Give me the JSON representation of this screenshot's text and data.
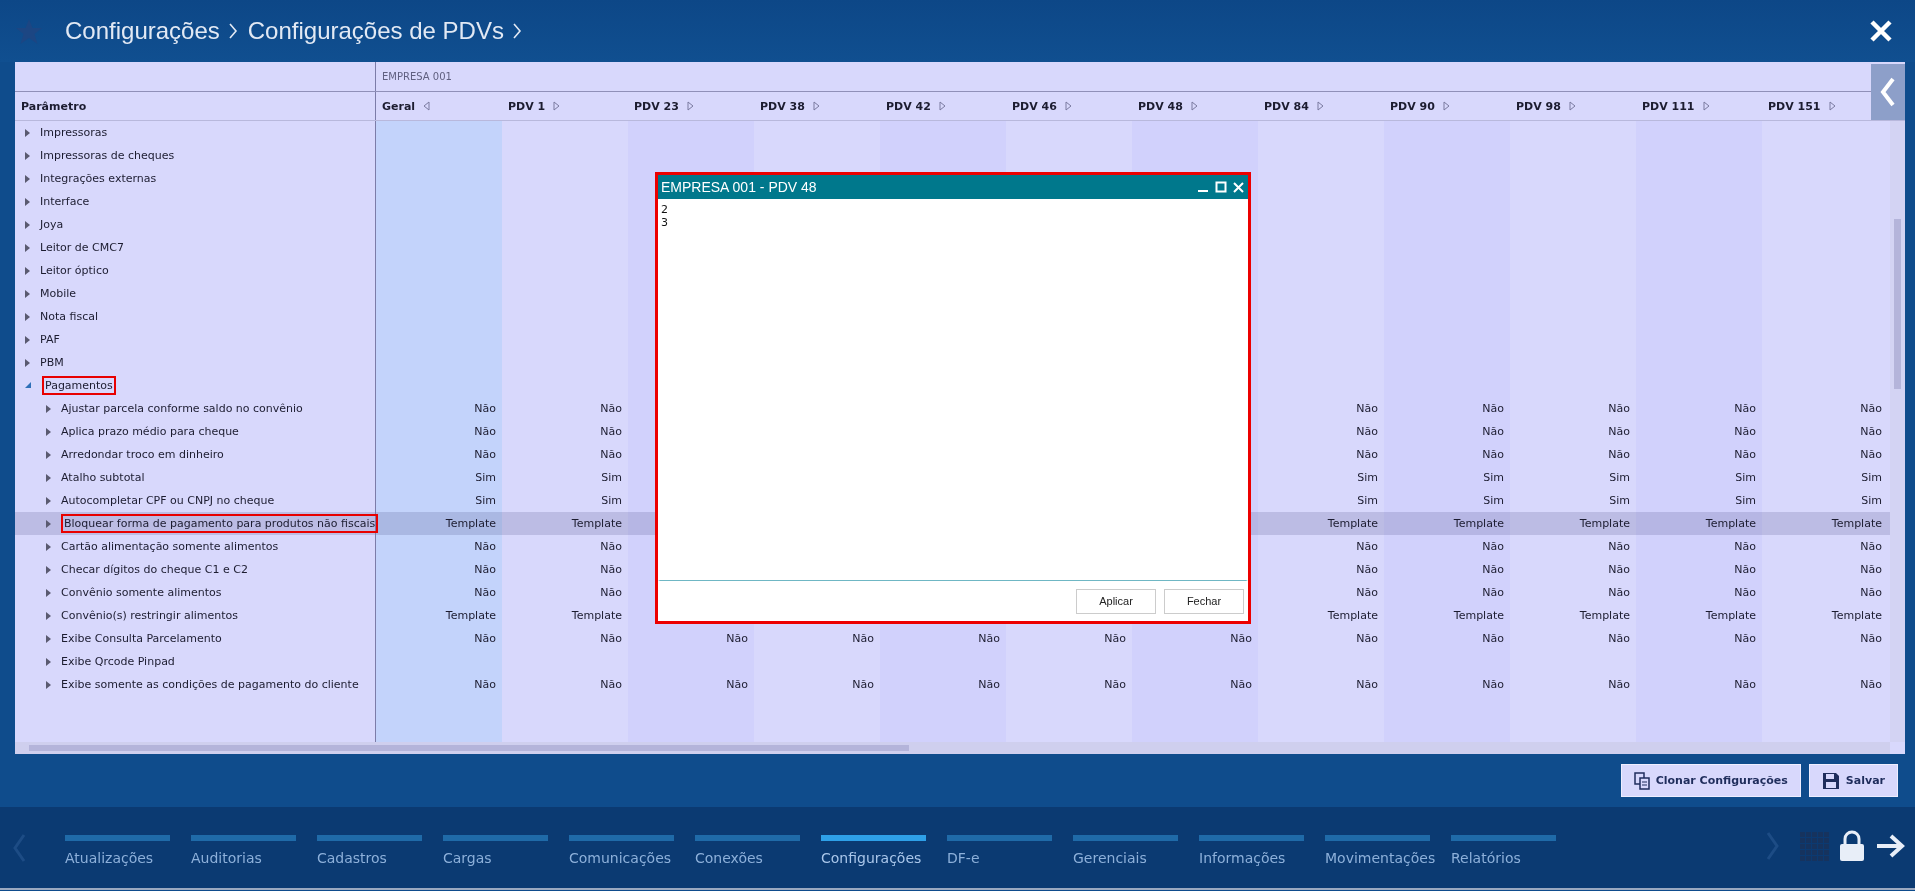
{
  "header": {
    "breadcrumbs": [
      "Configurações",
      "Configurações de PDVs"
    ]
  },
  "table": {
    "group": "EMPRESA 001",
    "first_column": "Parâmetro",
    "columns": [
      {
        "label": "Geral",
        "arrow_left": true
      },
      {
        "label": "PDV 1",
        "arrow_left": false
      },
      {
        "label": "PDV 23",
        "arrow_left": false
      },
      {
        "label": "PDV 38",
        "arrow_left": false
      },
      {
        "label": "PDV 42",
        "arrow_left": false
      },
      {
        "label": "PDV 46",
        "arrow_left": false
      },
      {
        "label": "PDV 48",
        "arrow_left": false
      },
      {
        "label": "PDV 84",
        "arrow_left": false
      },
      {
        "label": "PDV 90",
        "arrow_left": false
      },
      {
        "label": "PDV 98",
        "arrow_left": false
      },
      {
        "label": "PDV 111",
        "arrow_left": false
      },
      {
        "label": "PDV 151",
        "arrow_left": false
      }
    ],
    "rows": [
      {
        "label": "Impressoras",
        "expanded": false,
        "selected": false,
        "annotated": false
      },
      {
        "label": "Impressoras de cheques",
        "expanded": false,
        "selected": false,
        "annotated": false
      },
      {
        "label": "Integrações externas",
        "expanded": false,
        "selected": false,
        "annotated": false
      },
      {
        "label": "Interface",
        "expanded": false,
        "selected": false,
        "annotated": false
      },
      {
        "label": "Joya",
        "expanded": false,
        "selected": false,
        "annotated": false
      },
      {
        "label": "Leitor de CMC7",
        "expanded": false,
        "selected": false,
        "annotated": false
      },
      {
        "label": "Leitor óptico",
        "expanded": false,
        "selected": false,
        "annotated": false
      },
      {
        "label": "Mobile",
        "expanded": false,
        "selected": false,
        "annotated": false
      },
      {
        "label": "Nota fiscal",
        "expanded": false,
        "selected": false,
        "annotated": false
      },
      {
        "label": "PAF",
        "expanded": false,
        "selected": false,
        "annotated": false
      },
      {
        "label": "PBM",
        "expanded": false,
        "selected": false,
        "annotated": false
      },
      {
        "label": "Pagamentos",
        "expanded": true,
        "selected": false,
        "annotated": true,
        "children": [
          {
            "label": "Ajustar parcela conforme saldo no convênio",
            "expanded": false,
            "selected": false,
            "annotated": false,
            "values": [
              "Não",
              "Não"
            ],
            "trailing_values": [
              "Não",
              "Não",
              "Não",
              "Não",
              "Não"
            ]
          },
          {
            "label": "Aplica prazo médio para cheque",
            "expanded": false,
            "selected": false,
            "annotated": false,
            "values": [
              "Não",
              "Não"
            ],
            "trailing_values": [
              "Não",
              "Não",
              "Não",
              "Não",
              "Não"
            ]
          },
          {
            "label": "Arredondar troco em dinheiro",
            "expanded": false,
            "selected": false,
            "annotated": false,
            "values": [
              "Não",
              "Não"
            ],
            "trailing_values": [
              "Não",
              "Não",
              "Não",
              "Não",
              "Não"
            ]
          },
          {
            "label": "Atalho subtotal",
            "expanded": false,
            "selected": false,
            "annotated": false,
            "values": [
              "Sim",
              "Sim"
            ],
            "trailing_values": [
              "Sim",
              "Sim",
              "Sim",
              "Sim",
              "Sim"
            ]
          },
          {
            "label": "Autocompletar CPF ou CNPJ no cheque",
            "expanded": false,
            "selected": false,
            "annotated": false,
            "values": [
              "Sim",
              "Sim"
            ],
            "trailing_values": [
              "Sim",
              "Sim",
              "Sim",
              "Sim",
              "Sim"
            ]
          },
          {
            "label": "Bloquear forma de pagamento para produtos não fiscais",
            "expanded": false,
            "selected": true,
            "annotated": true,
            "values": [
              "Template",
              "Template"
            ],
            "trailing_values": [
              "Template",
              "Template",
              "Template",
              "Template",
              "Template"
            ]
          },
          {
            "label": "Cartão alimentação somente alimentos",
            "expanded": false,
            "selected": false,
            "annotated": false,
            "values": [
              "Não",
              "Não"
            ],
            "trailing_values": [
              "Não",
              "Não",
              "Não",
              "Não",
              "Não"
            ]
          },
          {
            "label": "Checar dígitos do cheque C1 e C2",
            "expanded": false,
            "selected": false,
            "annotated": false,
            "values": [
              "Não",
              "Não"
            ],
            "trailing_values": [
              "Não",
              "Não",
              "Não",
              "Não",
              "Não"
            ]
          },
          {
            "label": "Convênio somente alimentos",
            "expanded": false,
            "selected": false,
            "annotated": false,
            "values": [
              "Não",
              "Não"
            ],
            "trailing_values": [
              "Não",
              "Não",
              "Não",
              "Não",
              "Não"
            ]
          },
          {
            "label": "Convênio(s) restringir alimentos",
            "expanded": false,
            "selected": false,
            "annotated": false,
            "values": [
              "Template",
              "Template"
            ],
            "trailing_values": [
              "Template",
              "Template",
              "Template",
              "Template",
              "Template"
            ]
          },
          {
            "label": "Exibe Consulta Parcelamento",
            "expanded": false,
            "selected": false,
            "annotated": false,
            "values": [
              "Não",
              "Não",
              "Não",
              "Não",
              "Não",
              "Não",
              "Não",
              "Não",
              "Não",
              "Não",
              "Não",
              "Não"
            ]
          },
          {
            "label": "Exibe Qrcode Pinpad",
            "expanded": false,
            "selected": false,
            "annotated": false
          },
          {
            "label": "Exibe somente as condições de pagamento do cliente",
            "expanded": false,
            "selected": false,
            "annotated": false,
            "values": [
              "Não",
              "Não",
              "Não",
              "Não",
              "Não",
              "Não",
              "Não",
              "Não",
              "Não",
              "Não",
              "Não",
              "Não"
            ]
          }
        ]
      }
    ]
  },
  "dialog": {
    "title": "EMPRESA 001 - PDV 48",
    "text": "2\n3",
    "buttons": [
      "Aplicar",
      "Fechar"
    ],
    "annotated": true
  },
  "actions": [
    {
      "label": "Clonar Configurações",
      "kind": "copy"
    },
    {
      "label": "Salvar",
      "kind": "save"
    }
  ],
  "nav": {
    "items": [
      {
        "label": "Atualizações",
        "selected": false
      },
      {
        "label": "Auditorias",
        "selected": false
      },
      {
        "label": "Cadastros",
        "selected": false
      },
      {
        "label": "Cargas",
        "selected": false
      },
      {
        "label": "Comunicações",
        "selected": false
      },
      {
        "label": "Conexões",
        "selected": false
      },
      {
        "label": "Configurações",
        "selected": true
      },
      {
        "label": "DF-e",
        "selected": false
      },
      {
        "label": "Gerenciais",
        "selected": false
      },
      {
        "label": "Informações",
        "selected": false
      },
      {
        "label": "Movimentações",
        "selected": false
      },
      {
        "label": "Relatórios",
        "selected": false
      }
    ]
  }
}
